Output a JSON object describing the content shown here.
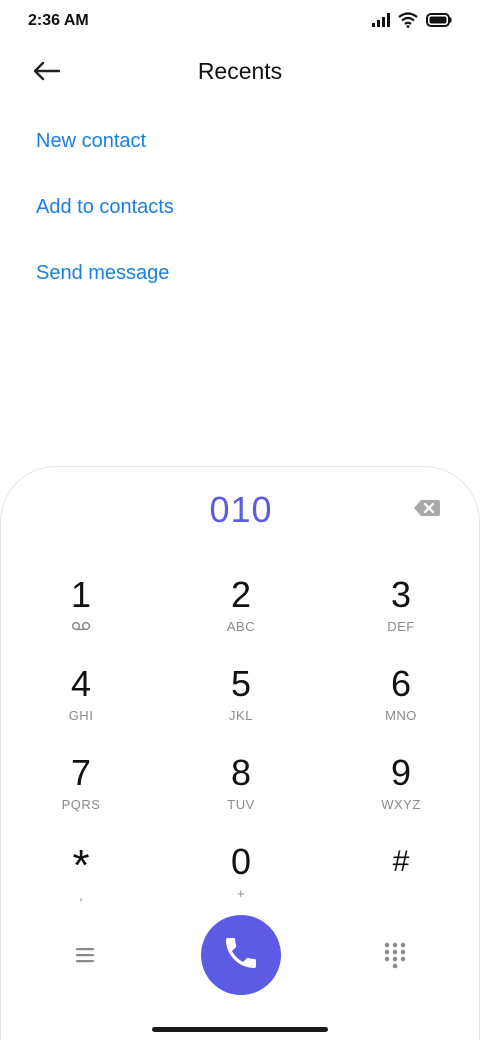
{
  "status_bar": {
    "time": "2:36 AM",
    "icons": [
      "signal-icon",
      "wifi-icon",
      "battery-icon"
    ]
  },
  "header": {
    "back_icon": "arrow-left-icon",
    "title": "Recents"
  },
  "actions": [
    {
      "label": "New contact"
    },
    {
      "label": "Add to contacts"
    },
    {
      "label": "Send message"
    }
  ],
  "dialpad": {
    "number": "010",
    "backspace_icon": "backspace-icon",
    "keys": [
      {
        "digit": "1",
        "letters": ""
      },
      {
        "digit": "2",
        "letters": "ABC"
      },
      {
        "digit": "3",
        "letters": "DEF"
      },
      {
        "digit": "4",
        "letters": "GHI"
      },
      {
        "digit": "5",
        "letters": "JKL"
      },
      {
        "digit": "6",
        "letters": "MNO"
      },
      {
        "digit": "7",
        "letters": "PQRS"
      },
      {
        "digit": "8",
        "letters": "TUV"
      },
      {
        "digit": "9",
        "letters": "WXYZ"
      },
      {
        "digit": "*",
        "letters": ","
      },
      {
        "digit": "0",
        "letters": "+"
      },
      {
        "digit": "#",
        "letters": ""
      }
    ],
    "key1_sub_icon": "voicemail-icon"
  },
  "bottom_bar": {
    "menu_icon": "menu-icon",
    "call_icon": "phone-icon",
    "keypad_icon": "dialpad-icon"
  },
  "colors": {
    "accent": "#5b5be4",
    "link": "#1a7fde"
  }
}
